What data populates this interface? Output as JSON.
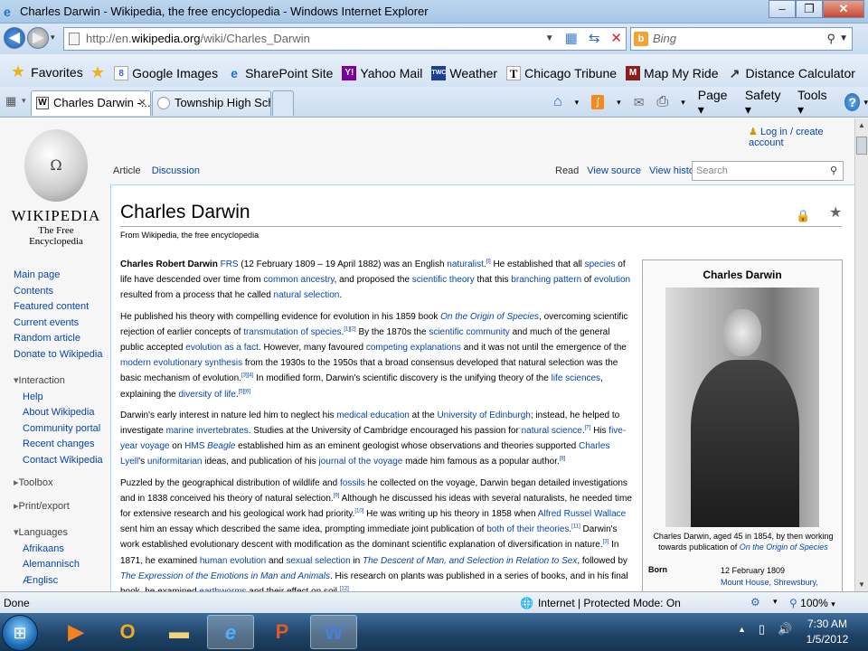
{
  "window": {
    "title": "Charles Darwin - Wikipedia, the free encyclopedia - Windows Internet Explorer",
    "minimize": "–",
    "restore": "❐",
    "close": "✕"
  },
  "nav": {
    "url_prefix": "http://en.",
    "url_host": "wikipedia.org",
    "url_path": "/wiki/Charles_Darwin",
    "search_placeholder": "Bing",
    "back_glyph": "◀",
    "forward_glyph": "▶"
  },
  "favorites": {
    "label": "Favorites",
    "links": [
      {
        "label": "Google Images",
        "icon": "google-icon"
      },
      {
        "label": "SharePoint Site",
        "icon": "ie-icon"
      },
      {
        "label": "Yahoo Mail",
        "icon": "yahoo-icon"
      },
      {
        "label": "Weather",
        "icon": "twc-icon"
      },
      {
        "label": "Chicago Tribune",
        "icon": "tribune-icon"
      },
      {
        "label": "Map My Ride",
        "icon": "mapmyride-icon"
      },
      {
        "label": "Distance Calculator",
        "icon": "arrow-icon"
      }
    ]
  },
  "tabs": [
    {
      "label": "Charles Darwin -...",
      "close": "✕"
    },
    {
      "label": "Township High Sch..."
    }
  ],
  "commands": {
    "page": "Page ▾",
    "safety": "Safety ▾",
    "tools": "Tools ▾",
    "help": "?"
  },
  "wiki": {
    "logo_char": "Ω",
    "wordmark": "WIKIPEDIA",
    "tagline": "The Free Encyclopedia",
    "login": "Log in / create account",
    "tabs": {
      "article": "Article",
      "discussion": "Discussion",
      "read": "Read",
      "view_source": "View source",
      "view_history": "View history"
    },
    "search_placeholder": "Search",
    "nav_links": [
      "Main page",
      "Contents",
      "Featured content",
      "Current events",
      "Random article",
      "Donate to Wikipedia"
    ],
    "interaction": {
      "heading": "Interaction",
      "links": [
        "Help",
        "About Wikipedia",
        "Community portal",
        "Recent changes",
        "Contact Wikipedia"
      ]
    },
    "toolbox": "Toolbox",
    "printexport": "Print/export",
    "languages": {
      "heading": "Languages",
      "links": [
        "Afrikaans",
        "Alemannisch",
        "Ænglisc"
      ]
    },
    "title": "Charles Darwin",
    "from": "From Wikipedia, the free encyclopedia",
    "infobox": {
      "title": "Charles Darwin",
      "caption": "Charles Darwin, aged 45 in 1854, by then working towards publication of",
      "caption_link": "On the Origin of Species",
      "born_label": "Born",
      "born_date": "12 February 1809",
      "born_place": "Mount House, Shrewsbury,"
    }
  },
  "status": {
    "done": "Done",
    "zone": "Internet | Protected Mode: On",
    "zoom": "100%"
  },
  "clock": {
    "time": "7:30 AM",
    "date": "1/5/2012"
  },
  "colors": {
    "link": "#0645ad",
    "taskbar": "#1e4266"
  }
}
